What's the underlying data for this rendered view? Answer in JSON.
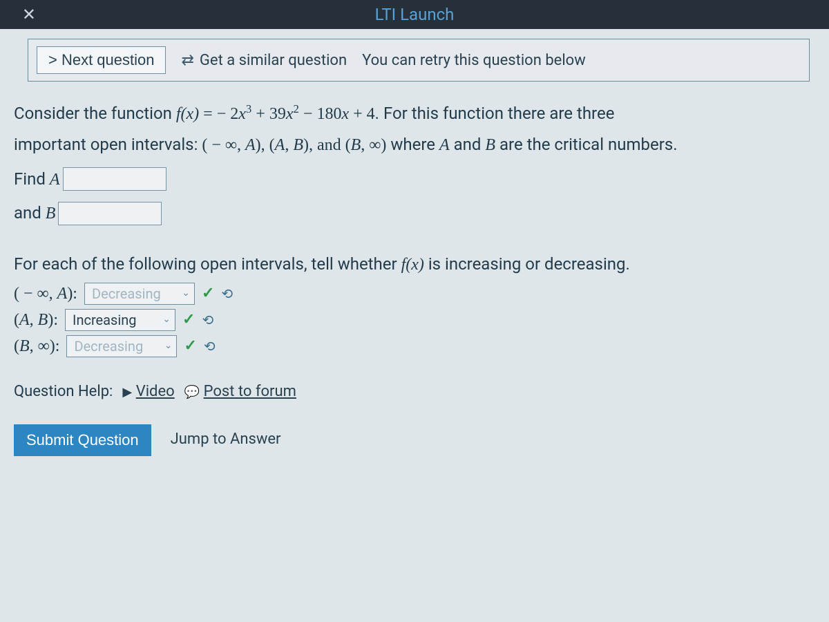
{
  "header": {
    "close": "✕",
    "title": "LTI Launch"
  },
  "toolbar": {
    "next": "> Next question",
    "similar": "Get a similar question",
    "shuffle_glyph": "⇄",
    "retry": "You can retry this question below"
  },
  "question": {
    "intro_a": "Consider the function ",
    "fx": "f(x)",
    "equals": " = ",
    "poly": " − 2x³ + 39x² − 180x + 4",
    "intro_b": ". For this function there are three",
    "intervals_line_a": "important open intervals: ",
    "intervals_math": "( − ∞, A), (A, B), and (B, ∞)",
    "intervals_line_b": " where A and B are the critical numbers.",
    "find_a": "Find A",
    "and_b": "and B",
    "input_a_value": "",
    "input_b_value": "",
    "section_prompt_a": "For each of the following open intervals, tell whether ",
    "section_prompt_fx": "f(x)",
    "section_prompt_b": " is increasing or decreasing.",
    "intervals": [
      {
        "label": "( − ∞, A):",
        "value": "Decreasing",
        "faded": true
      },
      {
        "label": "(A, B):",
        "value": "Increasing",
        "faded": false
      },
      {
        "label": "(B, ∞):",
        "value": "Decreasing",
        "faded": true
      }
    ],
    "check_glyph": "✓",
    "redo_glyph": "⟲",
    "chev_glyph": "⌄"
  },
  "help": {
    "label": "Question Help:",
    "video": "Video",
    "forum": "Post to forum",
    "video_glyph": "▶",
    "forum_glyph": "💬"
  },
  "footer": {
    "submit": "Submit Question",
    "jump": "Jump to Answer"
  }
}
